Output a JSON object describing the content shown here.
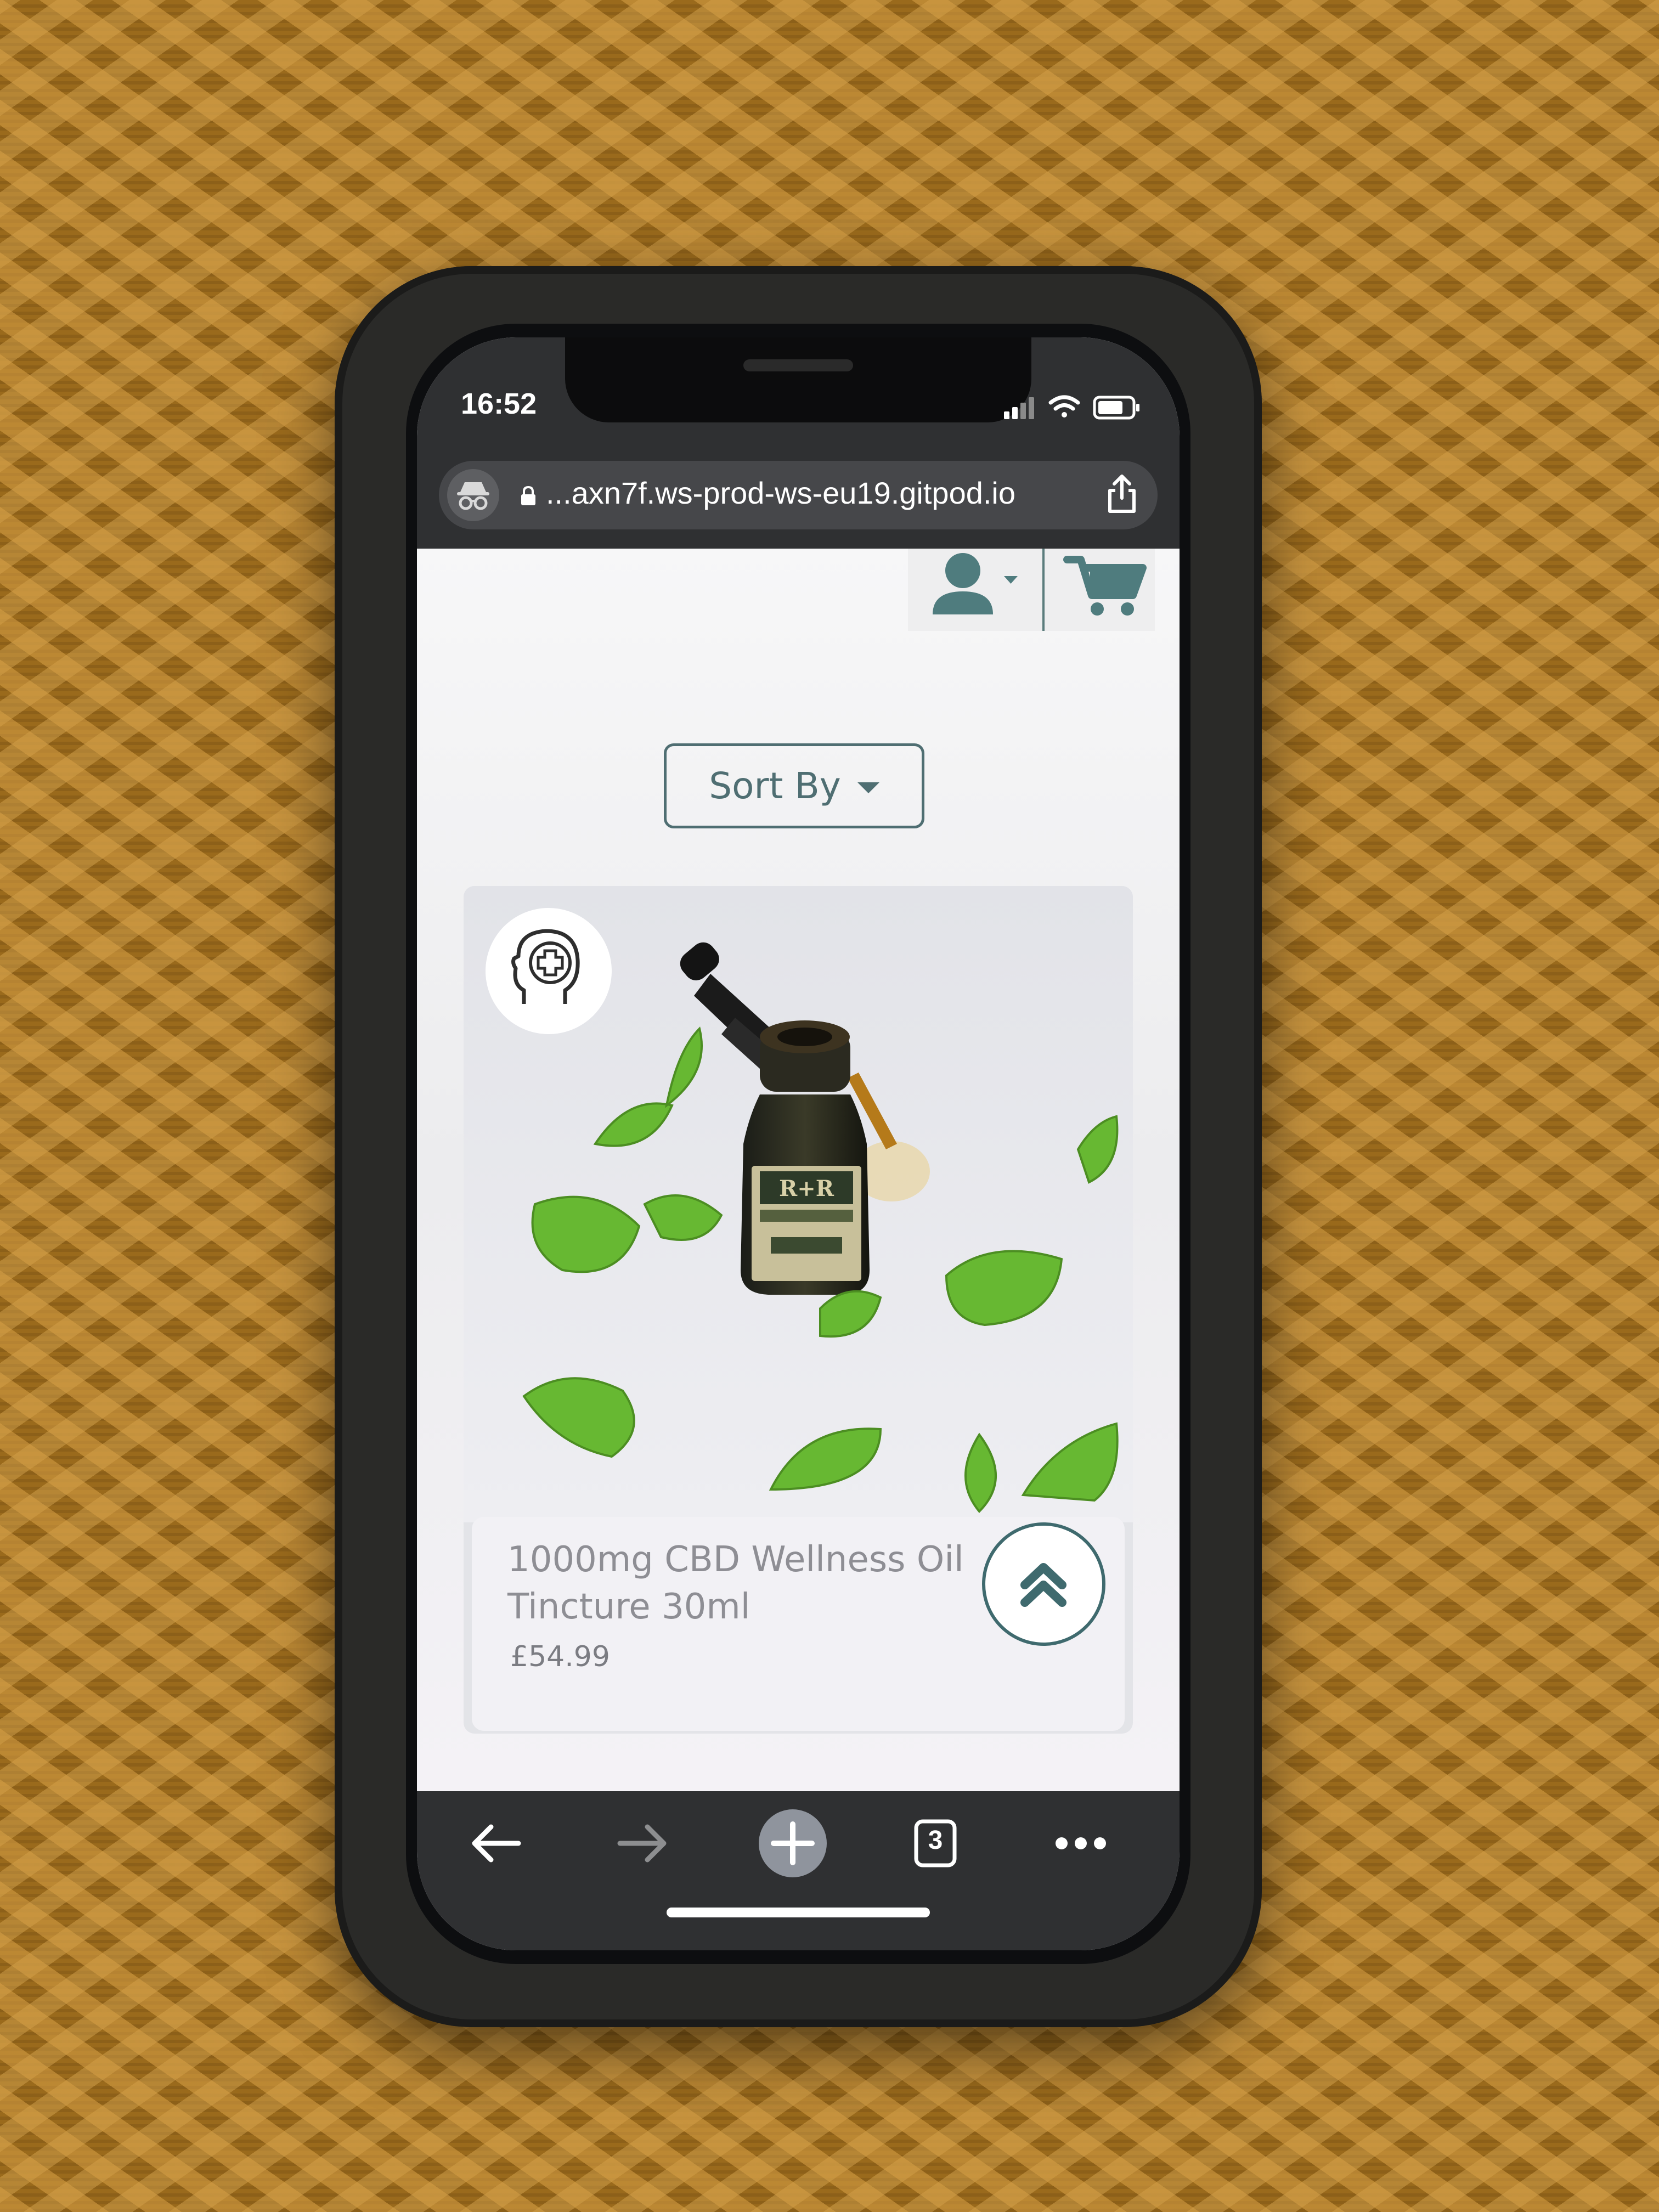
{
  "status_bar": {
    "time": "16:52"
  },
  "browser": {
    "url": "...axn7f.ws-prod-ws-eu19.gitpod.io",
    "tab_count": "3"
  },
  "page": {
    "sort_label": "Sort By",
    "product": {
      "title": "1000mg CBD Wellness Oil Tincture 30ml",
      "price": "£54.99"
    }
  },
  "colors": {
    "brand_teal": "#4f6e72",
    "toolbar": "#2f3032",
    "page_background": "#f4f5f7"
  },
  "icons": {
    "header": [
      "user-icon",
      "cart-icon"
    ],
    "badge": "head-medical-cross-icon",
    "back_to_top": "double-chevron-up-icon",
    "toolbar": [
      "back-arrow-icon",
      "forward-arrow-icon",
      "new-tab-plus-icon",
      "tab-count-icon",
      "more-icon"
    ]
  }
}
